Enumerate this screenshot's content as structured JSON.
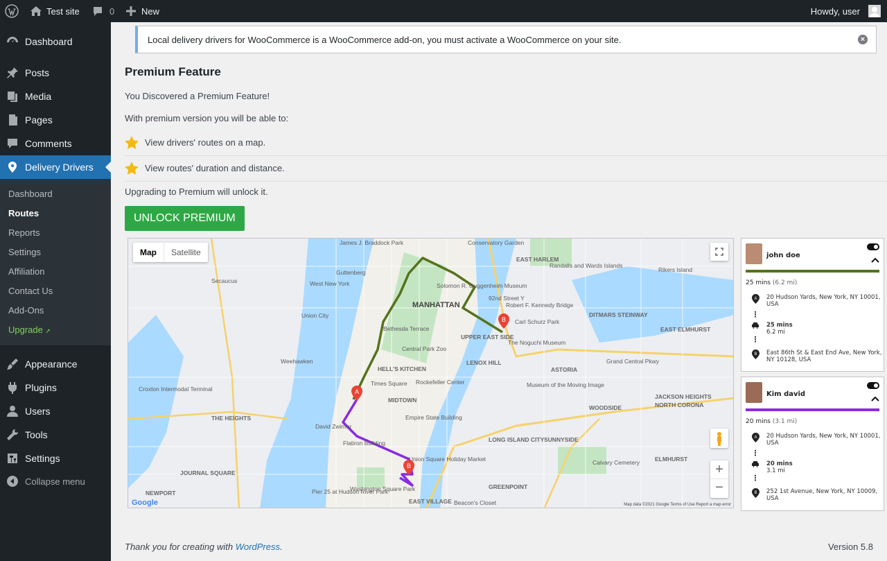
{
  "adminbar": {
    "site": "Test site",
    "comments_count": "0",
    "new_label": "New",
    "greeting": "Howdy, user"
  },
  "sidebar": {
    "items": [
      {
        "label": "Dashboard",
        "icon": "dashboard-icon"
      },
      {
        "label": "Posts",
        "icon": "pin-icon"
      },
      {
        "label": "Media",
        "icon": "media-icon"
      },
      {
        "label": "Pages",
        "icon": "pages-icon"
      },
      {
        "label": "Comments",
        "icon": "comment-icon"
      },
      {
        "label": "Delivery Drivers",
        "icon": "location-icon"
      },
      {
        "label": "Appearance",
        "icon": "brush-icon"
      },
      {
        "label": "Plugins",
        "icon": "plug-icon"
      },
      {
        "label": "Users",
        "icon": "user-icon"
      },
      {
        "label": "Tools",
        "icon": "wrench-icon"
      },
      {
        "label": "Settings",
        "icon": "sliders-icon"
      },
      {
        "label": "Collapse menu",
        "icon": "collapse-icon"
      }
    ],
    "submenu": [
      "Dashboard",
      "Routes",
      "Reports",
      "Settings",
      "Affiliation",
      "Contact Us",
      "Add-Ons",
      "Upgrade"
    ],
    "upgrade_symbol": "➚"
  },
  "notice": {
    "text": "Local delivery drivers for WooCommerce is a WooCommerce add-on, you must activate a WooCommerce on your site.",
    "close": "×"
  },
  "content": {
    "title": "Premium Feature",
    "intro": "You Discovered a Premium Feature!",
    "lead": "With premium version you will be able to:",
    "features": [
      "View drivers' routes on a map.",
      "View routes' duration and distance."
    ],
    "upgrade_text": "Upgrading to Premium will unlock it.",
    "button": "UNLOCK PREMIUM"
  },
  "map": {
    "tab_map": "Map",
    "tab_satellite": "Satellite",
    "labels": [
      "James J. Braddock Park",
      "Guttenberg",
      "West New York",
      "Secaucus",
      "Union City",
      "Weehawken",
      "Croxton Intermodal Terminal",
      "THE HEIGHTS",
      "JOURNAL SQUARE",
      "NEWPORT",
      "Pier 25 at Hudson River Park",
      "Conservatory Garden",
      "EAST HARLEM",
      "Randalls and Wards Islands",
      "Rikers Island",
      "Solomon R. Guggenheim Museum",
      "MANHATTAN",
      "92nd Street Y",
      "Robert F. Kennedy Bridge",
      "Carl Schurz Park",
      "DITMARS STEINWAY",
      "EAST ELMHURST",
      "Bethesda Terrace",
      "UPPER EAST SIDE",
      "The Noguchi Museum",
      "Central Park Zoo",
      "LENOX HILL",
      "ASTORIA",
      "HELL'S KITCHEN",
      "Rockefeller Center",
      "Times Square",
      "MIDTOWN",
      "Museum of the Moving Image",
      "WOODSIDE",
      "JACKSON HEIGHTS",
      "NORTH CORONA",
      "Empire State Building",
      "David Zwirner",
      "Flatiron Building",
      "LONG ISLAND CITY",
      "SUNNYSIDE",
      "Calvary Cemetery",
      "ELMHURST",
      "Union Square Holiday Market",
      "Washington Square Park",
      "EAST VILLAGE",
      "GREENPOINT",
      "Beacon's Closet",
      "Grand Central Pkwy"
    ],
    "footer": "Map data ©2021 Google   Terms of Use   Report a map error",
    "logo": "Google"
  },
  "drivers": [
    {
      "name": "john doe",
      "color": "#55731d",
      "duration": "25 mins",
      "distance": "(6.2 mi)",
      "from": "20 Hudson Yards, New York, NY 10001, USA",
      "leg_time": "25 mins",
      "leg_dist": "6.2 mi",
      "to": "East 86th St & East End Ave, New York, NY 10128, USA"
    },
    {
      "name": "Kim david",
      "color": "#8a2be2",
      "duration": "20 mins",
      "distance": "(3.1 mi)",
      "from": "20 Hudson Yards, New York, NY 10001, USA",
      "leg_time": "20 mins",
      "leg_dist": "3.1 mi",
      "to": "252 1st Avenue, New York, NY 10009, USA"
    }
  ],
  "footer": {
    "thanks": "Thank you for creating with",
    "link": "WordPress",
    "period": ".",
    "version": "Version 5.8"
  }
}
